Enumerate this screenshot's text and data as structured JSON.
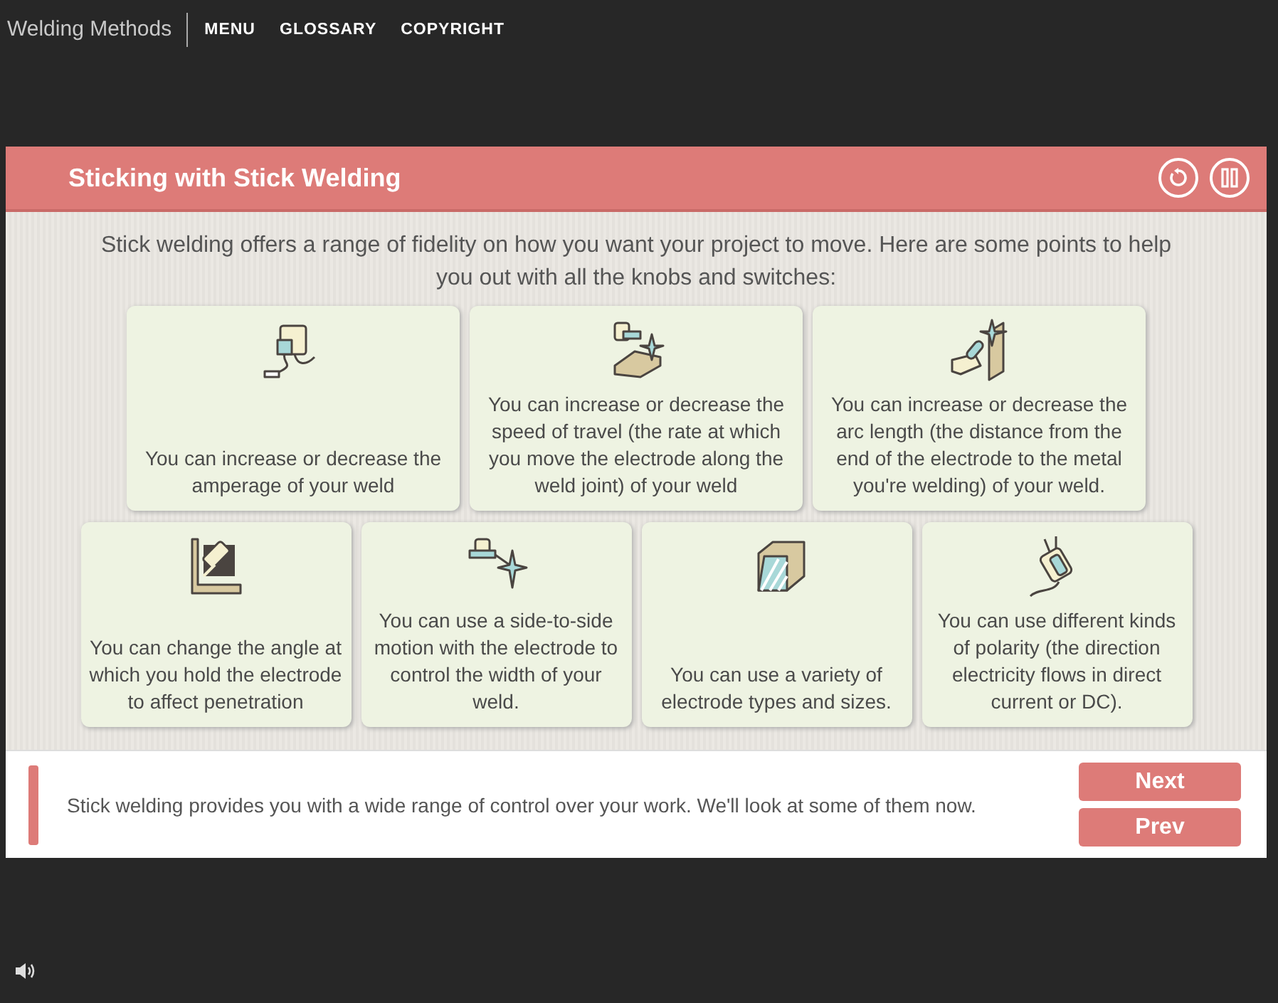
{
  "app": {
    "title": "Welding Methods",
    "menu": [
      "MENU",
      "GLOSSARY",
      "COPYRIGHT"
    ]
  },
  "slide": {
    "title": "Sticking with Stick Welding",
    "intro": "Stick welding offers a range of fidelity on how you want your project to move. Here are some points to help you out with all the knobs and switches:",
    "cards": [
      {
        "text": "You can increase or decrease the amperage of your weld"
      },
      {
        "text": "You can increase or decrease the speed of travel (the rate at which you move the electrode along the weld joint) of your weld"
      },
      {
        "text": "You can increase or decrease the arc length (the distance from the end of the electrode to the metal you're welding) of your weld."
      },
      {
        "text": "You can change the angle at which you hold the electrode to affect penetration"
      },
      {
        "text": "You can use a side-to-side motion with the electrode to control the width of your weld."
      },
      {
        "text": "You can use a variety of electrode types and sizes."
      },
      {
        "text": "You can use different kinds of polarity (the direction electricity flows in direct current or DC)."
      }
    ],
    "caption": "Stick welding provides you with a wide range of control over your work. We'll look at some of them now.",
    "buttons": [
      "Next",
      "Prev"
    ]
  }
}
